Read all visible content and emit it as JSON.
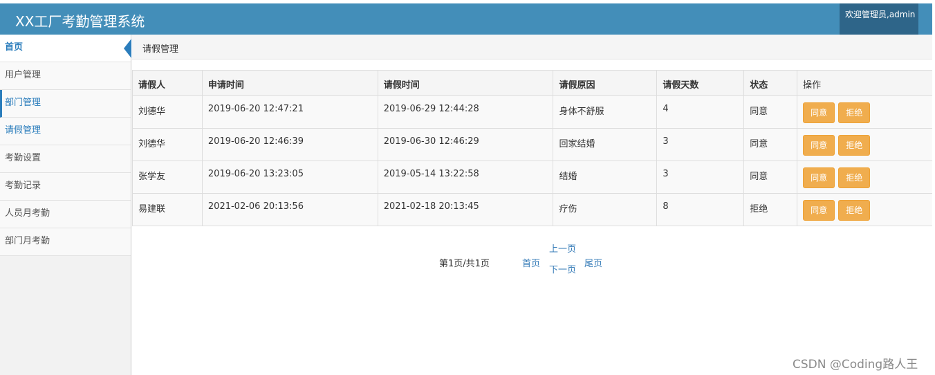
{
  "header": {
    "title": "XX工厂考勤管理系统",
    "welcome": "欢迎管理员,admin"
  },
  "sidebar": {
    "items": [
      {
        "label": "首页"
      },
      {
        "label": "用户管理"
      },
      {
        "label": "部门管理"
      },
      {
        "label": "请假管理"
      },
      {
        "label": "考勤设置"
      },
      {
        "label": "考勤记录"
      },
      {
        "label": "人员月考勤"
      },
      {
        "label": "部门月考勤"
      }
    ]
  },
  "breadcrumb": "请假管理",
  "table": {
    "headers": [
      "请假人",
      "申请时间",
      "请假时间",
      "请假原因",
      "请假天数",
      "状态",
      "操作"
    ],
    "rows": [
      [
        "刘德华",
        "2019-06-20 12:47:21",
        "2019-06-29 12:44:28",
        "身体不舒服",
        "4",
        "同意"
      ],
      [
        "刘德华",
        "2019-06-20 12:46:39",
        "2019-06-30 12:46:29",
        "回家结婚",
        "3",
        "同意"
      ],
      [
        "张学友",
        "2019-06-20 13:23:05",
        "2019-05-14 13:22:58",
        "结婚",
        "3",
        "同意"
      ],
      [
        "易建联",
        "2021-02-06 20:13:56",
        "2021-02-18 20:13:45",
        "疗伤",
        "8",
        "拒绝"
      ]
    ],
    "approve_label": "同意",
    "reject_label": "拒绝"
  },
  "pager": {
    "info": "第1页/共1页",
    "first": "首页",
    "prev": "上一页",
    "next": "下一页",
    "last": "尾页"
  },
  "watermark": "CSDN @Coding路人王",
  "colors": {
    "header": "#438eb9",
    "welcome_bg": "#2e6589",
    "accent": "#2b7dbc",
    "warning": "#f0ad4e"
  }
}
